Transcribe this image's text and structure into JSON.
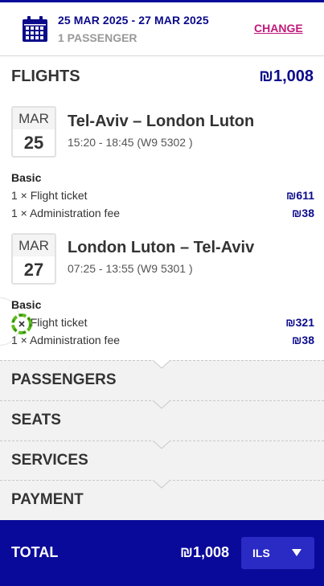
{
  "booking": {
    "dates": "25 MAR 2025 - 27 MAR 2025",
    "passengers": "1 PASSENGER",
    "change_label": "CHANGE"
  },
  "flights": {
    "heading": "FLIGHTS",
    "total": "₪1,008",
    "segments": [
      {
        "month": "MAR",
        "day": "25",
        "route": "Tel-Aviv – London Luton",
        "times": "15:20 - 18:45 (W9 5302 )",
        "fare": "Basic",
        "items": [
          {
            "label": "1 × Flight ticket",
            "amount": "₪611"
          },
          {
            "label": "1 × Administration fee",
            "amount": "₪38"
          }
        ]
      },
      {
        "month": "MAR",
        "day": "27",
        "route": "London Luton – Tel-Aviv",
        "times": "07:25 - 13:55 (W9 5301 )",
        "fare": "Basic",
        "items": [
          {
            "label": "1 × Flight ticket",
            "amount": "₪321"
          },
          {
            "label": "1 × Administration fee",
            "amount": "₪38"
          }
        ]
      }
    ]
  },
  "stages": [
    "PASSENGERS",
    "SEATS",
    "SERVICES",
    "PAYMENT"
  ],
  "footer": {
    "total_label": "TOTAL",
    "total_amount": "₪1,008",
    "currency": "ILS"
  },
  "colors": {
    "brand_navy": "#0a0a9a",
    "price_navy": "#0a0a8a",
    "change_magenta": "#c2187a",
    "currency_button": "#2a2ac4",
    "stage_bg": "#f2f2f2"
  },
  "icons": [
    "calendar-icon",
    "caret-down-icon",
    "close-icon"
  ]
}
